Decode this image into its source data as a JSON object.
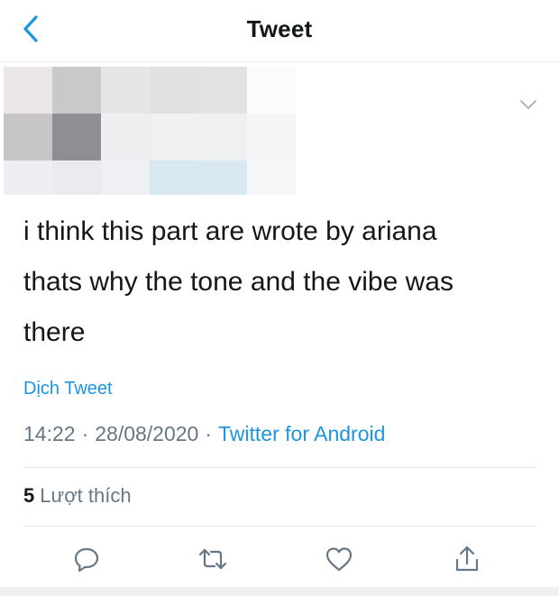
{
  "colors": {
    "accent": "#1b95e0",
    "text_primary": "#14171a",
    "text_secondary": "#657786",
    "divider": "#e1e8ed"
  },
  "header": {
    "title": "Tweet",
    "back_icon": "chevron-left-icon"
  },
  "author": {
    "obscured": true,
    "caret_icon": "chevron-down-icon"
  },
  "tweet": {
    "text": "i think this part are wrote by ariana\nthats why the tone and the vibe was\nthere",
    "translate_label": "Dịch Tweet",
    "time": "14:22",
    "date": "28/08/2020",
    "separator": "·",
    "source": "Twitter for Android",
    "likes_count": "5",
    "likes_label": "Lượt thích"
  },
  "actions": [
    {
      "name": "reply",
      "icon": "reply-icon"
    },
    {
      "name": "retweet",
      "icon": "retweet-icon"
    },
    {
      "name": "like",
      "icon": "heart-icon"
    },
    {
      "name": "share",
      "icon": "share-icon"
    }
  ]
}
